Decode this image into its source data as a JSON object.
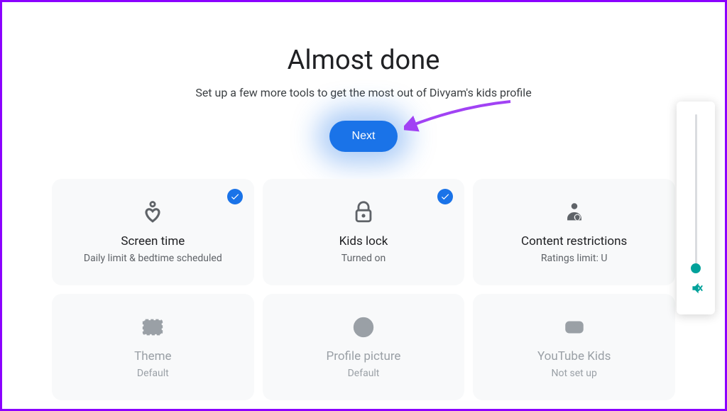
{
  "header": {
    "title": "Almost done",
    "subtitle": "Set up a few more tools to get the most out of Divyam's kids profile",
    "next_label": "Next"
  },
  "colors": {
    "primary": "#1a73e8",
    "annotation": "#a142f4",
    "teal": "#00a19a"
  },
  "cards": [
    {
      "icon": "heart-person-icon",
      "title": "Screen time",
      "subtitle": "Daily limit & bedtime scheduled",
      "checked": true
    },
    {
      "icon": "lock-icon",
      "title": "Kids lock",
      "subtitle": "Turned on",
      "checked": true
    },
    {
      "icon": "person-shield-icon",
      "title": "Content restrictions",
      "subtitle": "Ratings limit: U",
      "checked": false
    },
    {
      "icon": "image-icon",
      "title": "Theme",
      "subtitle": "Default",
      "checked": false
    },
    {
      "icon": "smiley-icon",
      "title": "Profile picture",
      "subtitle": "Default",
      "checked": false
    },
    {
      "icon": "youtube-icon",
      "title": "YouTube Kids",
      "subtitle": "Not set up",
      "checked": false
    }
  ],
  "side_panel": {
    "slider_value": 0
  }
}
